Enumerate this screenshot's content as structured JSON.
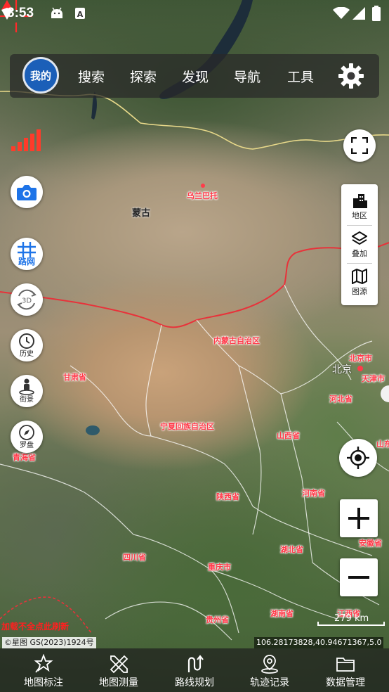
{
  "status": {
    "time": "3:53"
  },
  "topbar": {
    "avatar_label": "我的",
    "menu": [
      "搜索",
      "探索",
      "发现",
      "导航",
      "工具"
    ]
  },
  "left_controls": {
    "roadnet": "路网",
    "threed": "3D",
    "history": "历史",
    "streetview": "街景",
    "compass": "罗盘"
  },
  "right_panel": {
    "region": "地区",
    "overlay": "叠加",
    "source": "图源"
  },
  "map_labels": {
    "mongolia": "蒙古",
    "ulaanbaatar": "乌兰巴托",
    "inner_mongolia": "内蒙古自治区",
    "beijing_city": "北京市",
    "beijing": "北京",
    "tianjin": "天津市",
    "hebei": "河北省",
    "gansu": "甘肃省",
    "ningxia": "宁夏回族自治区",
    "shanxi": "山西省",
    "shandong": "山东",
    "qinghai": "青海省",
    "shaanxi": "陕西省",
    "henan": "河南省",
    "anhui": "安徽省",
    "hubei": "湖北省",
    "sichuan": "四川省",
    "chongqing": "重庆市",
    "guizhou": "贵州省",
    "hunan": "湖南省",
    "jiangxi": "江西省"
  },
  "warning": "加载不全点此刷新",
  "copyright": "©星图 GS(2023)1924号",
  "coordinates": "106.28173828,40.94671367,5.0",
  "scale": "279 km",
  "bottom_nav": [
    "地图标注",
    "地图测量",
    "路线规划",
    "轨迹记录",
    "数据管理"
  ]
}
